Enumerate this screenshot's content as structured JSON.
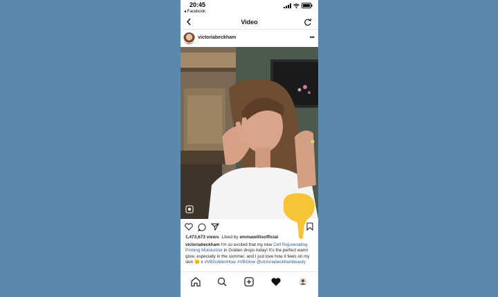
{
  "status_bar": {
    "time": "20:45",
    "back_app": "◂ Facebook"
  },
  "header": {
    "title": "Video"
  },
  "post": {
    "username": "victoriabeckham",
    "views": "1,473,673 views",
    "liked_by_prefix": "· Liked by ",
    "liked_by_user": "emmawillisofficial"
  },
  "caption": {
    "user": "victoriabeckham",
    "text1": " I'm so excited that my new ",
    "tag1": "Cell Rejuvenating Priming Moisturizer",
    "text2": " in Golden drops today! It's the perfect warm glow, especially in the summer, and I just love how it feels on my skin 😊 x ",
    "tag2": "#VBGoldenHour #VBGlow",
    "text3": " ",
    "tag3": "@victoriabeckhambeauty"
  },
  "colors": {
    "background": "#5b88ad",
    "link": "#2d5a8e",
    "pointer": "#f7c437"
  }
}
